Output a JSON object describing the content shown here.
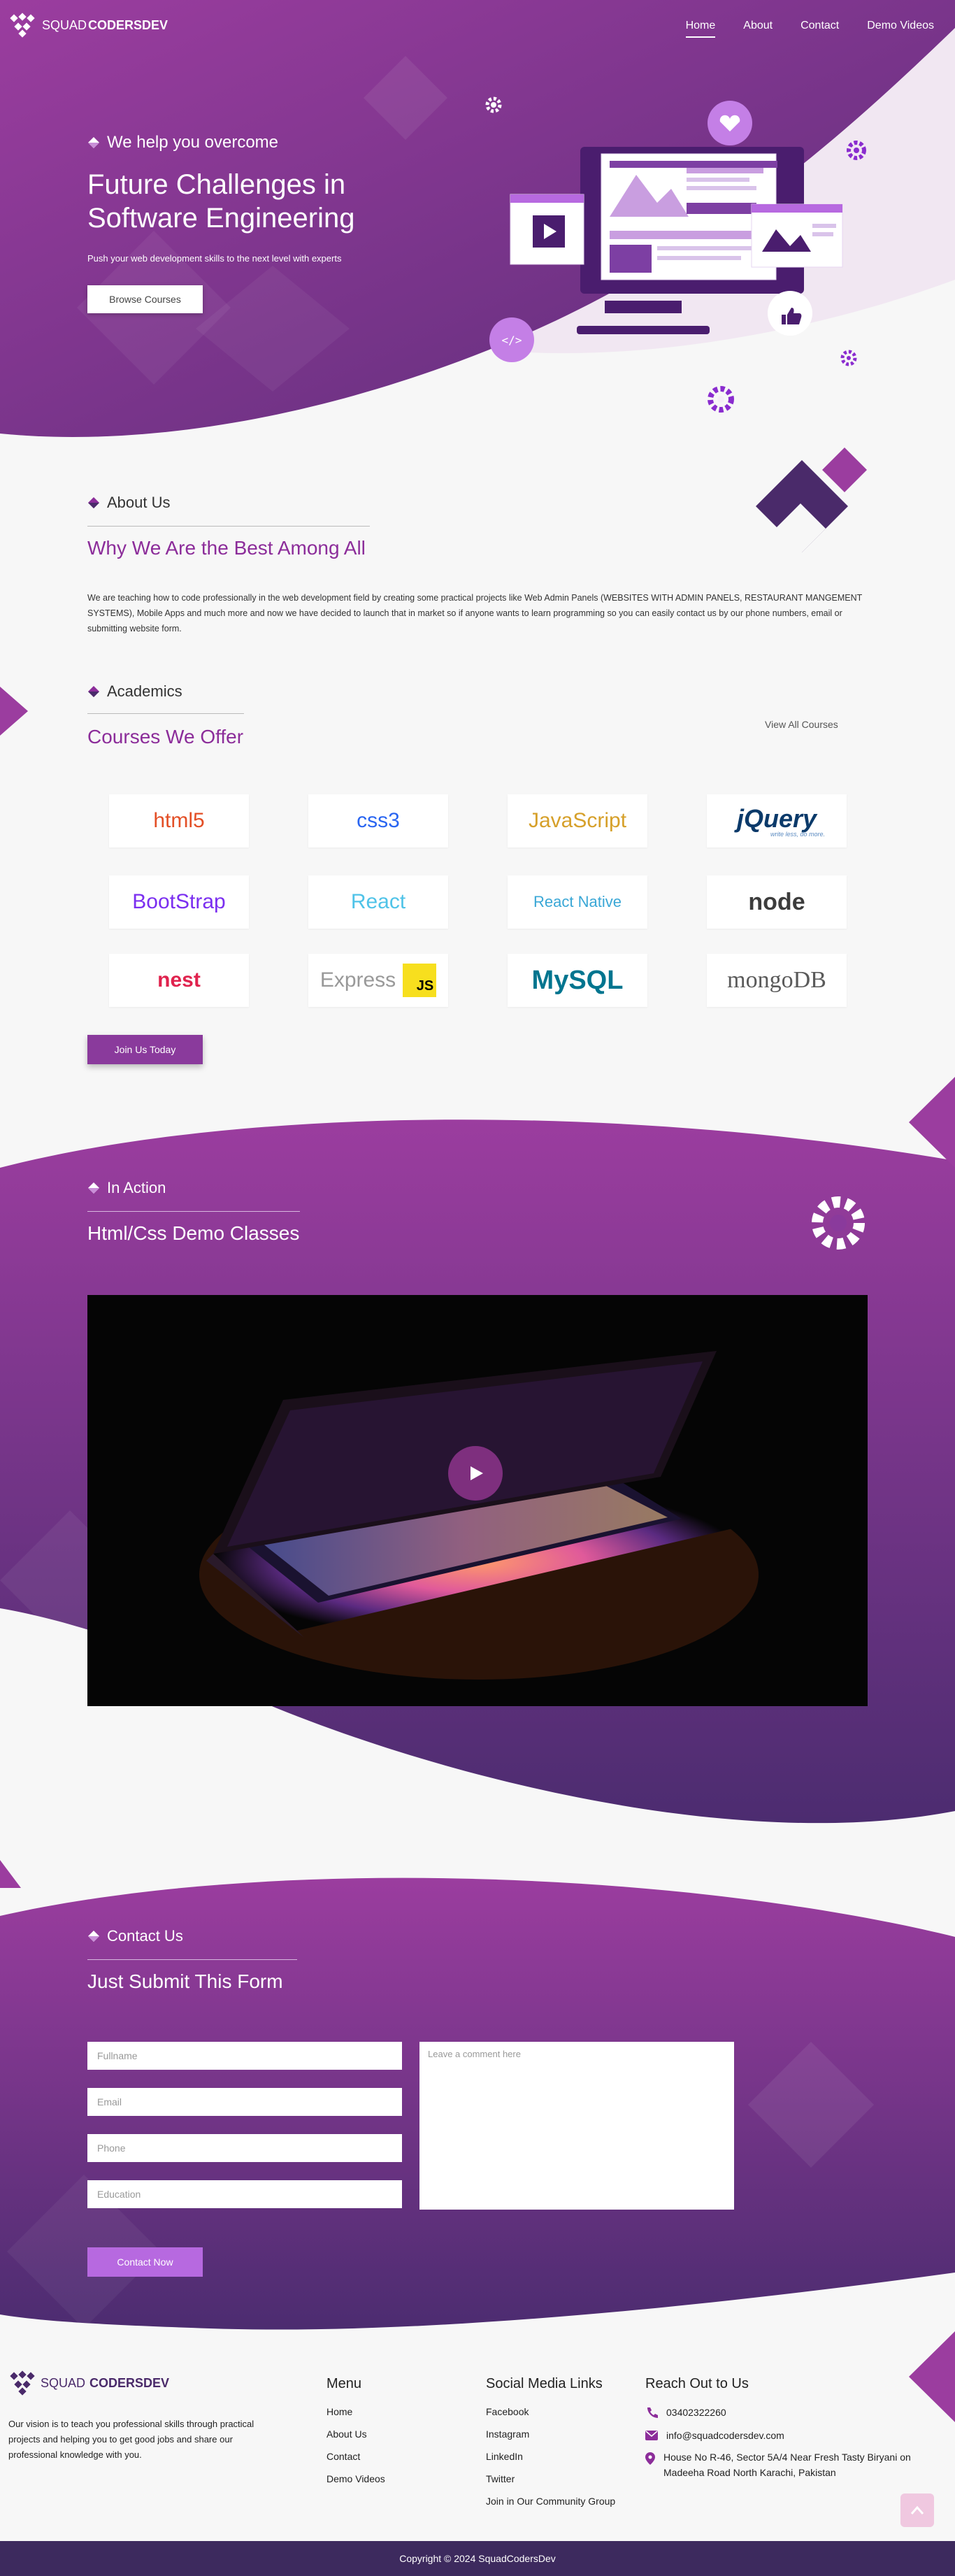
{
  "nav": {
    "logo_light": "SQUAD",
    "logo_bold": "CODERSDEV",
    "items": [
      {
        "label": "Home",
        "active": true
      },
      {
        "label": "About",
        "active": false
      },
      {
        "label": "Contact",
        "active": false
      },
      {
        "label": "Demo Videos",
        "active": false
      }
    ]
  },
  "hero": {
    "tagline": "We help you overcome",
    "title_line1": "Future Challenges in",
    "title_line2": "Software Engineering",
    "subtitle": "Push your web development skills to the next level with experts",
    "button": "Browse Courses",
    "code_badge": "</>"
  },
  "about": {
    "tag": "About Us",
    "heading": "Why We Are the Best Among All",
    "body": "We are teaching how to code professionally in the web development field by creating some practical projects like Web Admin Panels (WEBSITES WITH ADMIN PANELS, RESTAURANT MANGEMENT SYSTEMS), Mobile Apps and much more and now we have decided to launch that in market so if anyone wants to learn programming so you can easily contact us by our phone numbers, email or submitting website form."
  },
  "academics": {
    "tag": "Academics",
    "heading": "Courses We Offer",
    "view_all": "View All Courses",
    "courses": [
      {
        "name": "html5",
        "color": "#e34f26"
      },
      {
        "name": "css3",
        "color": "#2965f1"
      },
      {
        "name": "JavaScript",
        "color": "#d6a02a"
      },
      {
        "name": "jQuery",
        "color": "#0b3a6a"
      },
      {
        "name": "BootStrap",
        "color": "#7b2ff0"
      },
      {
        "name": "React",
        "color": "#4fc3e8"
      },
      {
        "name": "React Native",
        "color": "#3aa7d6"
      },
      {
        "name": "node",
        "color": "#3c3c3c"
      },
      {
        "name": "nest",
        "color": "#e0234e"
      },
      {
        "name": "Express",
        "color": "#999999"
      },
      {
        "name": "MySQL",
        "color": "#00758f"
      },
      {
        "name": "mongoDB",
        "color": "#5a5a5a"
      }
    ],
    "js_badge": "JS",
    "jquery_tagline": "write less, do more.",
    "button": "Join Us Today"
  },
  "action": {
    "tag": "In Action",
    "heading": "Html/Css Demo Classes"
  },
  "contact": {
    "tag": "Contact Us",
    "heading": "Just Submit This Form",
    "fields": [
      "Fullname",
      "Email",
      "Phone",
      "Education"
    ],
    "comment_placeholder": "Leave a comment here",
    "button": "Contact Now"
  },
  "footer": {
    "mission": "Our vision is to teach you professional skills through practical projects and helping you to get good jobs and share our professional knowledge with you.",
    "menu_title": "Menu",
    "menu": [
      "Home",
      "About Us",
      "Contact",
      "Demo Videos"
    ],
    "social_title": "Social Media Links",
    "social": [
      "Facebook",
      "Instagram",
      "LinkedIn",
      "Twitter",
      "Join in Our Community Group"
    ],
    "reach_title": "Reach Out to Us",
    "phone": "03402322260",
    "email": "info@squadcodersdev.com",
    "address": "House No R-46, Sector 5A/4 Near Fresh Tasty Biryani on Madeeha Road North Karachi, Pakistan",
    "copyright": "Copyright © 2024 SquadCodersDev"
  },
  "colors": {
    "purple": "#8a3a9c",
    "dark_purple": "#4a2a6a",
    "violet": "#b769e0",
    "footer_bar": "#3d2a5e"
  }
}
